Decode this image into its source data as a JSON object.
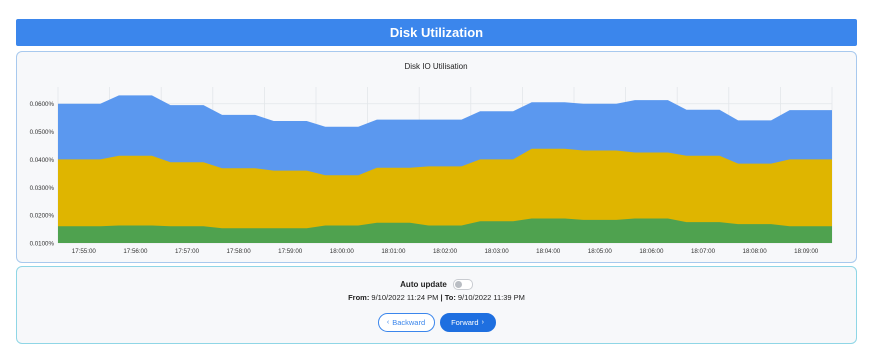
{
  "page": {
    "title": "Disk Utilization"
  },
  "chart_data": {
    "type": "area",
    "title": "Disk IO Utilisation",
    "x": [
      "17:55:00",
      "17:56:00",
      "17:57:00",
      "17:58:00",
      "17:59:00",
      "18:00:00",
      "18:01:00",
      "18:02:00",
      "18:03:00",
      "18:04:00",
      "18:05:00",
      "18:06:00",
      "18:07:00",
      "18:08:00",
      "18:09:00"
    ],
    "y_ticks": [
      "0.0100%",
      "0.0200%",
      "0.0300%",
      "0.0400%",
      "0.0500%",
      "0.0600%"
    ],
    "ylim": [
      0.01,
      0.066
    ],
    "stacked": true,
    "series": [
      {
        "values": [
          0.016,
          0.0163,
          0.016,
          0.0153,
          0.0153,
          0.0163,
          0.0173,
          0.0163,
          0.0178,
          0.0188,
          0.0183,
          0.0188,
          0.0175,
          0.0168,
          0.016
        ]
      },
      {
        "values": [
          0.04,
          0.0413,
          0.039,
          0.0368,
          0.036,
          0.0343,
          0.037,
          0.0375,
          0.04,
          0.0438,
          0.0432,
          0.0425,
          0.0413,
          0.0385,
          0.04
        ]
      },
      {
        "values": [
          0.06,
          0.063,
          0.0595,
          0.056,
          0.0538,
          0.0517,
          0.0543,
          0.0543,
          0.0573,
          0.0605,
          0.06,
          0.0613,
          0.0578,
          0.054,
          0.0577
        ]
      }
    ],
    "colors": [
      "#4fa24f",
      "#dfb500",
      "#5b98ef"
    ],
    "grid": true,
    "legend": "none"
  },
  "controls": {
    "auto_update_label": "Auto update",
    "auto_update_on": false,
    "from_label": "From:",
    "from_value": "9/10/2022 11:24 PM",
    "separator": "|",
    "to_label": "To:",
    "to_value": "9/10/2022 11:39 PM",
    "backward_label": "Backward",
    "forward_label": "Forward",
    "backward_icon": "chevron-left-icon",
    "forward_icon": "chevron-right-icon"
  },
  "colors": {
    "accent": "#3b86ec",
    "forward_button": "#1e6fe0"
  }
}
